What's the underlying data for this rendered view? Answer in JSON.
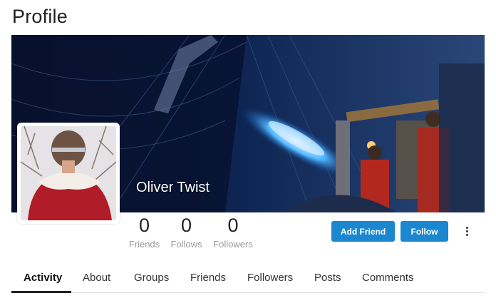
{
  "page": {
    "title": "Profile"
  },
  "profile": {
    "name": "Oliver Twist"
  },
  "stats": [
    {
      "count": "0",
      "label": "Friends"
    },
    {
      "count": "0",
      "label": "Follows"
    },
    {
      "count": "0",
      "label": "Followers"
    }
  ],
  "actions": {
    "add_friend": "Add Friend",
    "follow": "Follow",
    "more": "more-options-icon"
  },
  "tabs": [
    {
      "label": "Activity",
      "active": true
    },
    {
      "label": "About"
    },
    {
      "label": "Groups"
    },
    {
      "label": "Friends"
    },
    {
      "label": "Followers"
    },
    {
      "label": "Posts"
    },
    {
      "label": "Comments"
    }
  ],
  "colors": {
    "accent": "#1a87d0",
    "text": "#222222",
    "muted": "#9a9a9a"
  }
}
